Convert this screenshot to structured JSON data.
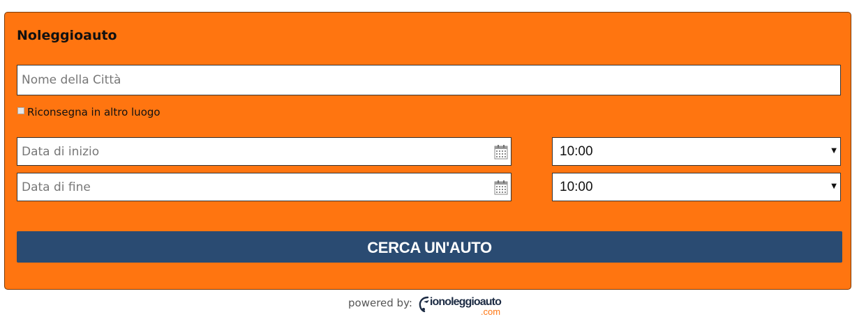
{
  "widget": {
    "title": "Noleggioauto",
    "city_placeholder": "Nome della Città",
    "return_elsewhere_label": "Riconsegna in altro luogo",
    "start_date_placeholder": "Data di inizio",
    "end_date_placeholder": "Data di fine",
    "start_time": "10:00",
    "end_time": "10:00",
    "search_button_label": "CERCA UN'AUTO"
  },
  "footer": {
    "powered_by": "powered by:",
    "logo_text": "ionoleggioauto",
    "logo_domain": ".com"
  },
  "icons": {
    "date_picker": "calendar-icon",
    "time_dropdown": "caret-down-icon",
    "logo": "car-swoosh-logo"
  },
  "colors": {
    "panel_background": "#ff7510",
    "button_background": "#2a4b72",
    "button_text": "#ffffff",
    "logo_text": "#1d2c44",
    "logo_domain": "#ff7510"
  }
}
